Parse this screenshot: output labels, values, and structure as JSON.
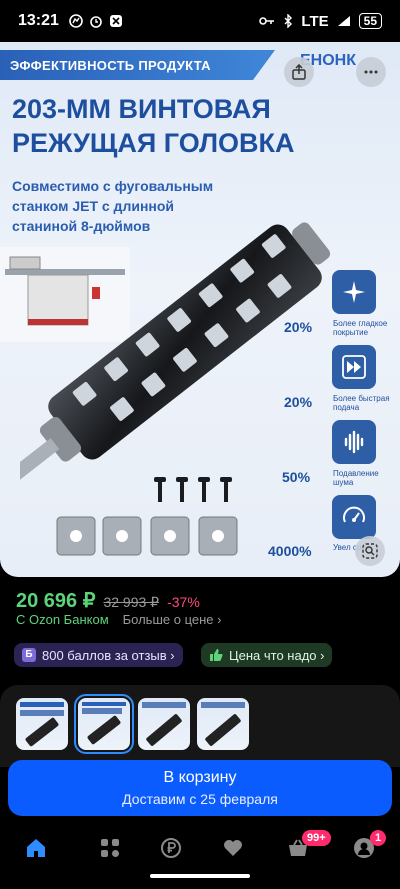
{
  "status": {
    "time": "13:21",
    "network": "LTE",
    "battery": "55"
  },
  "hero": {
    "badge": "ЭФФЕКТИВНОСТЬ ПРОДУКТА",
    "brand": "ЕНОНК",
    "title_line1": "203-ММ ВИНТОВАЯ",
    "title_line2": "РЕЖУЩАЯ ГОЛОВКА",
    "subtitle": "Совместимо с фуговальным станком JET с длинной станиной 8-дюймов",
    "features": [
      {
        "pct": "20%",
        "label": "Более гладкое покрытие",
        "icon": "sparkle-icon"
      },
      {
        "pct": "20%",
        "label": "Более быстрая подача",
        "icon": "fast-forward-icon"
      },
      {
        "pct": "50%",
        "label": "Подавление шума",
        "icon": "sound-wave-icon"
      },
      {
        "pct": "4000%",
        "label": "Увел срок",
        "icon": "speed-gauge-icon"
      }
    ]
  },
  "price": {
    "current": "20 696 ₽",
    "old": "32 993 ₽",
    "discount": "-37%",
    "ozon_bank": "С Ozon Банком",
    "more": "Больше о цене ›"
  },
  "chips": {
    "points": "800 баллов за отзыв ›",
    "points_icon_letter": "Б",
    "good_price": "Цена что надо ›"
  },
  "cart": {
    "title": "В корзину",
    "subtitle": "Доставим с 25 февраля"
  },
  "tabbar": {
    "cart_badge": "99+",
    "profile_badge": "1"
  },
  "colors": {
    "accent": "#0a5cff",
    "price": "#5dd37a",
    "discount": "#ff4a7b",
    "badge": "#ff2b6d"
  }
}
